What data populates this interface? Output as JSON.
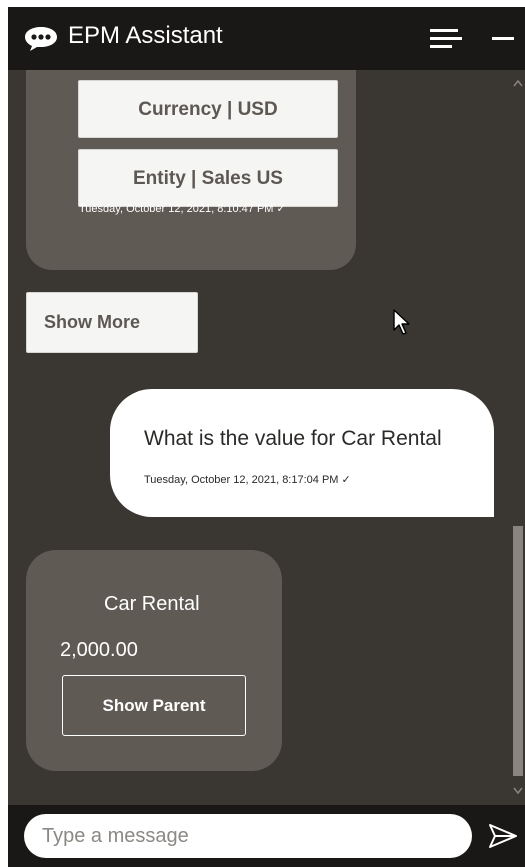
{
  "header": {
    "title": "EPM Assistant",
    "logo_icon": "chat-bubble-icon",
    "menu_icon": "hamburger-icon",
    "minimize_icon": "minimize-icon"
  },
  "messages": {
    "bot_choices": {
      "options": [
        "Currency | USD",
        "Entity | Sales US"
      ],
      "timestamp": "Tuesday, October 12, 2021, 8:10:47 PM ✓"
    },
    "show_more_label": "Show More",
    "user_message": {
      "text": "What is the value for Car Rental",
      "timestamp": "Tuesday, October 12, 2021, 8:17:04 PM ✓"
    },
    "bot_card": {
      "title": "Car Rental",
      "value": "2,000.00",
      "button_label": "Show Parent"
    }
  },
  "composer": {
    "placeholder": "Type a message",
    "send_icon": "send-icon"
  },
  "colors": {
    "header_bg": "#1a1816",
    "chat_bg": "#3a3632",
    "bot_bubble": "#605a55",
    "user_bubble": "#ffffff"
  }
}
